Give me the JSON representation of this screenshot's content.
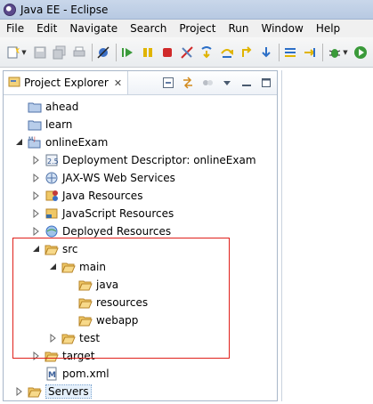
{
  "window": {
    "title": "Java EE - Eclipse"
  },
  "menu": [
    "File",
    "Edit",
    "Navigate",
    "Search",
    "Project",
    "Run",
    "Window",
    "Help"
  ],
  "toolbar": {
    "icons": [
      "new-icon",
      "save-icon",
      "save-all-icon",
      "print-icon",
      "skip-breakpoints-icon",
      "resume-icon",
      "suspend-icon",
      "terminate-icon",
      "disconnect-icon",
      "step-into-icon",
      "step-over-icon",
      "step-return-icon",
      "drop-to-frame-icon",
      "use-step-filters-icon",
      "debug-icon",
      "run-icon"
    ]
  },
  "explorer": {
    "tab_label": "Project Explorer",
    "close_glyph": "✕",
    "tree": [
      {
        "label": "ahead",
        "icon": "project-folder-icon",
        "depth": 0,
        "twisty": "none"
      },
      {
        "label": "learn",
        "icon": "project-folder-icon",
        "depth": 0,
        "twisty": "none"
      },
      {
        "label": "onlineExam",
        "icon": "web-project-icon",
        "depth": 0,
        "twisty": "expanded"
      },
      {
        "label": "Deployment Descriptor: onlineExam",
        "icon": "deployment-descriptor-icon",
        "depth": 1,
        "twisty": "collapsed"
      },
      {
        "label": "JAX-WS Web Services",
        "icon": "web-services-icon",
        "depth": 1,
        "twisty": "collapsed"
      },
      {
        "label": "Java Resources",
        "icon": "java-resources-icon",
        "depth": 1,
        "twisty": "collapsed"
      },
      {
        "label": "JavaScript Resources",
        "icon": "javascript-resources-icon",
        "depth": 1,
        "twisty": "collapsed"
      },
      {
        "label": "Deployed Resources",
        "icon": "deployed-resources-icon",
        "depth": 1,
        "twisty": "collapsed"
      },
      {
        "label": "src",
        "icon": "folder-icon",
        "depth": 1,
        "twisty": "expanded"
      },
      {
        "label": "main",
        "icon": "folder-icon",
        "depth": 2,
        "twisty": "expanded"
      },
      {
        "label": "java",
        "icon": "folder-icon",
        "depth": 3,
        "twisty": "none"
      },
      {
        "label": "resources",
        "icon": "folder-icon",
        "depth": 3,
        "twisty": "none"
      },
      {
        "label": "webapp",
        "icon": "folder-icon",
        "depth": 3,
        "twisty": "none"
      },
      {
        "label": "test",
        "icon": "folder-icon",
        "depth": 2,
        "twisty": "collapsed"
      },
      {
        "label": "target",
        "icon": "folder-icon",
        "depth": 1,
        "twisty": "collapsed"
      },
      {
        "label": "pom.xml",
        "icon": "maven-pom-icon",
        "depth": 1,
        "twisty": "none"
      },
      {
        "label": "Servers",
        "icon": "folder-icon",
        "depth": 0,
        "twisty": "collapsed",
        "selected": true
      }
    ]
  },
  "colors": {
    "highlight_border": "#e0201a",
    "folder": "#e8b84a",
    "project_folder": "#6a8fc7"
  }
}
